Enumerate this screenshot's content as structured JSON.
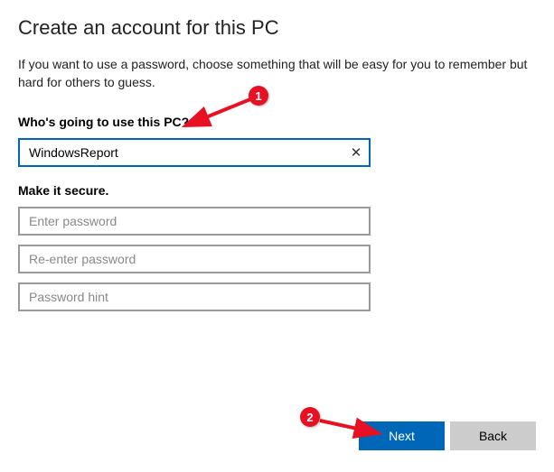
{
  "title": "Create an account for this PC",
  "description": "If you want to use a password, choose something that will be easy for you to remember but hard for others to guess.",
  "who_section": {
    "label": "Who's going to use this PC?",
    "username_value": "WindowsReport"
  },
  "secure_section": {
    "label": "Make it secure.",
    "password_placeholder": "Enter password",
    "reenter_placeholder": "Re-enter password",
    "hint_placeholder": "Password hint"
  },
  "buttons": {
    "next": "Next",
    "back": "Back"
  },
  "annotations": {
    "callout1": "1",
    "callout2": "2"
  }
}
